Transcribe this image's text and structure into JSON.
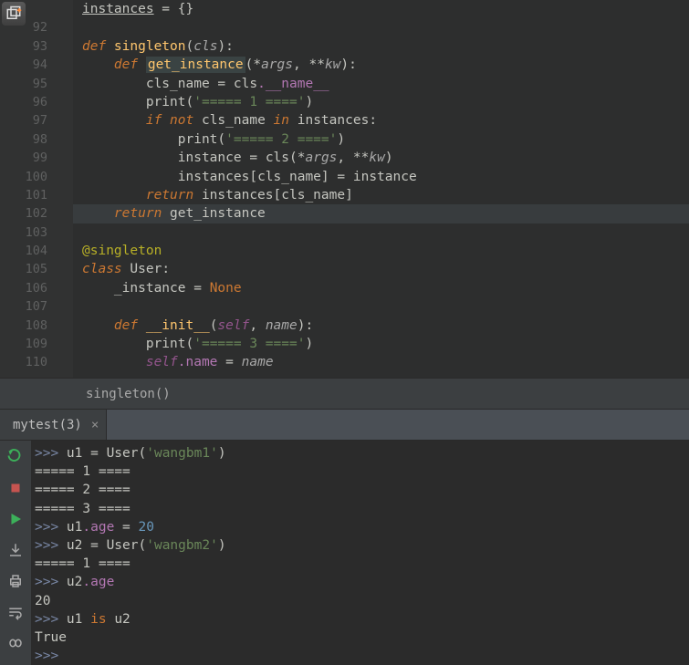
{
  "topIcon": "new-pane-icon",
  "gutter": {
    "start": 92,
    "halfAbove": true
  },
  "code": {
    "lines": [
      {
        "n": null,
        "t": "inst_dict"
      },
      {
        "n": 92,
        "t": "blank"
      },
      {
        "n": 93,
        "t": "def_singleton"
      },
      {
        "n": 94,
        "t": "def_get_instance"
      },
      {
        "n": 95,
        "t": "cls_name_assign"
      },
      {
        "n": 96,
        "t": "print1"
      },
      {
        "n": 97,
        "t": "if_not"
      },
      {
        "n": 98,
        "t": "print2"
      },
      {
        "n": 99,
        "t": "instance_assign"
      },
      {
        "n": 100,
        "t": "instances_set"
      },
      {
        "n": 101,
        "t": "return_inst"
      },
      {
        "n": 102,
        "t": "return_get_inst",
        "hl": true
      },
      {
        "n": 103,
        "t": "blank"
      },
      {
        "n": 104,
        "t": "decorator"
      },
      {
        "n": 105,
        "t": "class_user"
      },
      {
        "n": 106,
        "t": "inst_none"
      },
      {
        "n": 107,
        "t": "blank"
      },
      {
        "n": 108,
        "t": "def_init"
      },
      {
        "n": 109,
        "t": "print3"
      },
      {
        "n": 110,
        "t": "self_name"
      }
    ],
    "txt": {
      "instances": "instances",
      "eq_empty": " = {}",
      "def": "def ",
      "singleton": "singleton",
      "openp": "(",
      "cls": "cls",
      "closep_colon": "):",
      "get_instance": "get_instance",
      "star_args": "*",
      "args": "args",
      "comma": ", ",
      "dstar": "**",
      "kw_param": "kw",
      "cls_name": "cls_name",
      "eq": " = ",
      "cls_dot_name": "cls",
      "dunder_name": ".__name__",
      "print": "print",
      "s1": "'===== 1 ===='",
      "s2": "'===== 2 ===='",
      "s3": "'===== 3 ===='",
      "if": "if ",
      "not_": "not ",
      "in_": " in ",
      "colon": ":",
      "instance": "instance",
      "br_open": "[",
      "br_close": "]",
      "return_": "return ",
      "decorator": "@singleton",
      "class_": "class ",
      "User": "User",
      "_instance": "_instance",
      "none": "None",
      "init": "__init__",
      "self": "self",
      "name_param": "name",
      "self_dot_name": ".name",
      "close_paren": ")"
    }
  },
  "breadcrumb": "singleton()",
  "tabs": [
    {
      "label": "mytest(3)"
    }
  ],
  "console": {
    "lines": [
      {
        "type": "in",
        "content": [
          {
            "k": "prompt",
            "v": ">>> "
          },
          {
            "k": "t",
            "v": "u1 = User("
          },
          {
            "k": "str",
            "v": "'wangbm1'"
          },
          {
            "k": "t",
            "v": ")"
          }
        ]
      },
      {
        "type": "out",
        "content": [
          {
            "k": "t",
            "v": "===== 1 ===="
          }
        ]
      },
      {
        "type": "out",
        "content": [
          {
            "k": "t",
            "v": "===== 2 ===="
          }
        ]
      },
      {
        "type": "out",
        "content": [
          {
            "k": "t",
            "v": "===== 3 ===="
          }
        ]
      },
      {
        "type": "in",
        "content": [
          {
            "k": "prompt",
            "v": ">>> "
          },
          {
            "k": "t",
            "v": "u1"
          },
          {
            "k": "attr",
            "v": ".age"
          },
          {
            "k": "t",
            "v": " = "
          },
          {
            "k": "num",
            "v": "20"
          }
        ]
      },
      {
        "type": "in",
        "content": [
          {
            "k": "prompt",
            "v": ">>> "
          },
          {
            "k": "t",
            "v": "u2 = User("
          },
          {
            "k": "str",
            "v": "'wangbm2'"
          },
          {
            "k": "t",
            "v": ")"
          }
        ]
      },
      {
        "type": "out",
        "content": [
          {
            "k": "t",
            "v": "===== 1 ===="
          }
        ]
      },
      {
        "type": "in",
        "content": [
          {
            "k": "prompt",
            "v": ">>> "
          },
          {
            "k": "t",
            "v": "u2"
          },
          {
            "k": "attr",
            "v": ".age"
          }
        ]
      },
      {
        "type": "out",
        "content": [
          {
            "k": "t",
            "v": "20"
          }
        ]
      },
      {
        "type": "in",
        "content": [
          {
            "k": "prompt",
            "v": ">>> "
          },
          {
            "k": "t",
            "v": "u1 "
          },
          {
            "k": "ckw",
            "v": "is"
          },
          {
            "k": "t",
            "v": " u2"
          }
        ]
      },
      {
        "type": "out",
        "content": [
          {
            "k": "t",
            "v": "True"
          }
        ]
      },
      {
        "type": "in",
        "content": [
          {
            "k": "prompt",
            "v": ">>> "
          }
        ]
      }
    ]
  }
}
